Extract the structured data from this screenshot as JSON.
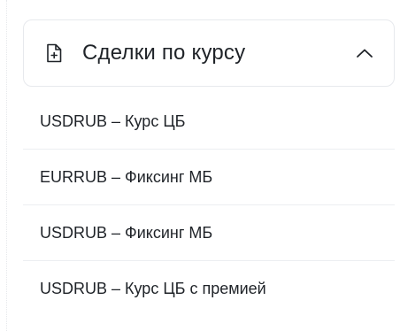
{
  "accordion": {
    "title": "Сделки по курсу",
    "icon": "document-plus-icon",
    "toggle_icon": "chevron-up-icon",
    "expanded": true,
    "items": [
      {
        "label": "USDRUB – Курс ЦБ"
      },
      {
        "label": "EURRUB – Фиксинг МБ"
      },
      {
        "label": "USDRUB – Фиксинг МБ"
      },
      {
        "label": "USDRUB – Курс ЦБ с премией"
      }
    ]
  },
  "colors": {
    "text": "#1f2328",
    "border": "#e7e9ed",
    "divider": "#eceef1",
    "background": "#ffffff"
  }
}
